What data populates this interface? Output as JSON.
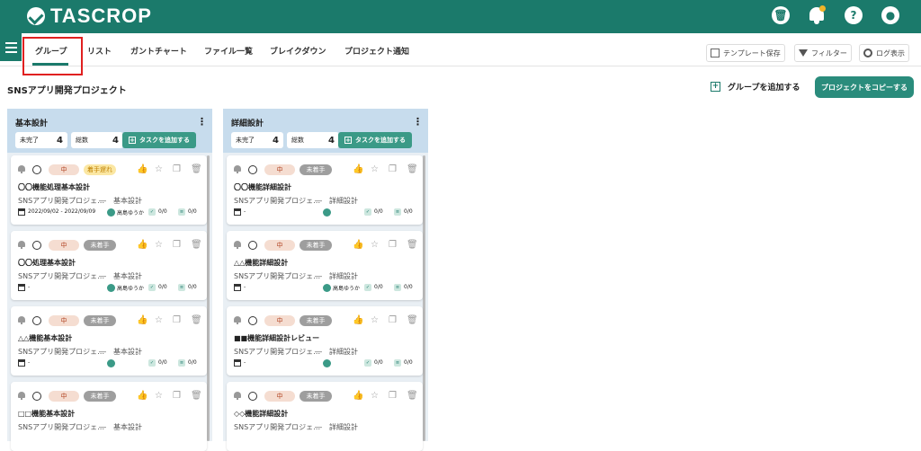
{
  "app": {
    "name": "TASCROP"
  },
  "topbar_icons": [
    "trash-icon",
    "bell-icon",
    "help-icon",
    "user-icon"
  ],
  "tabs": [
    {
      "label": "グループ",
      "active": true
    },
    {
      "label": "リスト"
    },
    {
      "label": "ガントチャート"
    },
    {
      "label": "ファイル一覧"
    },
    {
      "label": "ブレイクダウン"
    },
    {
      "label": "プロジェクト通知"
    }
  ],
  "toolbar": {
    "template_save": "テンプレート保存",
    "filter": "フィルター",
    "log_show": "ログ表示"
  },
  "project": {
    "title": "SNSアプリ開発プロジェクト",
    "add_group": "グループを追加する",
    "copy": "プロジェクトをコピーする"
  },
  "columns": [
    {
      "title": "基本設計",
      "incomplete_label": "未完了",
      "incomplete": "4",
      "total_label": "総数",
      "total": "4",
      "add_task": "タスクを追加する",
      "cards": [
        {
          "priority": "中",
          "status": "着手遅れ",
          "late": true,
          "name": "〇〇機能処理基本設計",
          "project": "SNSアプリ開発プロジェ…",
          "group": "―　基本設計",
          "date": "2022/09/02 - 2022/09/09",
          "user": "高島ゆうか",
          "subtasks": "0/0",
          "files": "0/0"
        },
        {
          "priority": "中",
          "status": "未着手",
          "name": "〇〇処理基本設計",
          "project": "SNSアプリ開発プロジェ…",
          "group": "―　基本設計",
          "date": "-",
          "user": "高島ゆうか",
          "subtasks": "0/0",
          "files": "0/0"
        },
        {
          "priority": "中",
          "status": "未着手",
          "name": "△△機能基本設計",
          "project": "SNSアプリ開発プロジェ…",
          "group": "―　基本設計",
          "date": "-",
          "user": "",
          "subtasks": "0/0",
          "files": "0/0"
        },
        {
          "priority": "中",
          "status": "未着手",
          "name": "□□機能基本設計",
          "project": "SNSアプリ開発プロジェ…",
          "group": "―　基本設計",
          "date": "",
          "user": "",
          "subtasks": "",
          "files": ""
        }
      ]
    },
    {
      "title": "詳細設計",
      "incomplete_label": "未完了",
      "incomplete": "4",
      "total_label": "総数",
      "total": "4",
      "add_task": "タスクを追加する",
      "cards": [
        {
          "priority": "中",
          "status": "未着手",
          "name": "〇〇機能詳細設計",
          "project": "SNSアプリ開発プロジェ…",
          "group": "―　詳細設計",
          "date": "-",
          "user": "",
          "subtasks": "0/0",
          "files": "0/0"
        },
        {
          "priority": "中",
          "status": "未着手",
          "name": "△△機能詳細設計",
          "project": "SNSアプリ開発プロジェ…",
          "group": "―　詳細設計",
          "date": "-",
          "user": "高島ゆうか",
          "subtasks": "0/0",
          "files": "0/0"
        },
        {
          "priority": "中",
          "status": "未着手",
          "name": "■■機能詳細設計レビュー",
          "project": "SNSアプリ開発プロジェ…",
          "group": "―　詳細設計",
          "date": "-",
          "user": "",
          "subtasks": "0/0",
          "files": "0/0"
        },
        {
          "priority": "中",
          "status": "未着手",
          "name": "◇◇機能詳細設計",
          "project": "SNSアプリ開発プロジェ…",
          "group": "―　詳細設計",
          "date": "",
          "user": "",
          "subtasks": "",
          "files": ""
        }
      ]
    }
  ],
  "colors": {
    "brand": "#1b7a6b",
    "accent": "#3b9a87",
    "highlight": "#e02020"
  }
}
